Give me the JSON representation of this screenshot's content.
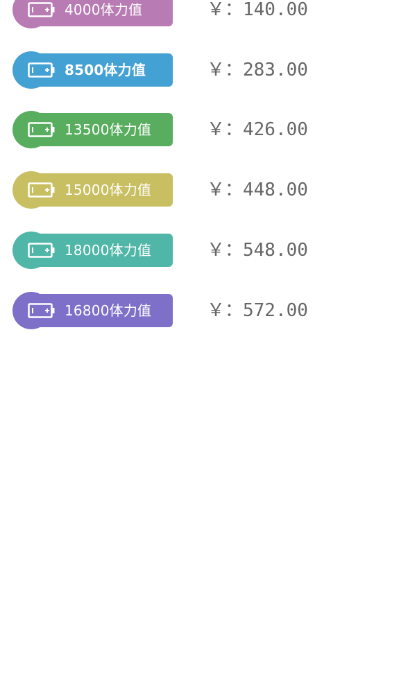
{
  "colors": {
    "price_text": "#666666",
    "background": "#ffffff"
  },
  "packages": [
    {
      "label": "4000体力值",
      "price": "￥：140.00",
      "color": "#b87bb3",
      "icon": "battery-icon"
    },
    {
      "label": "8500体力值",
      "price": "￥：283.00",
      "color": "#44a1d3",
      "icon": "battery-icon"
    },
    {
      "label": "13500体力值",
      "price": "￥：426.00",
      "color": "#58ad5f",
      "icon": "battery-icon"
    },
    {
      "label": "15000体力值",
      "price": "￥：448.00",
      "color": "#c8bf63",
      "icon": "battery-icon"
    },
    {
      "label": "18000体力值",
      "price": "￥：548.00",
      "color": "#50b6a7",
      "icon": "battery-icon"
    },
    {
      "label": "16800体力值",
      "price": "￥：572.00",
      "color": "#7e70c9",
      "icon": "battery-icon"
    }
  ]
}
